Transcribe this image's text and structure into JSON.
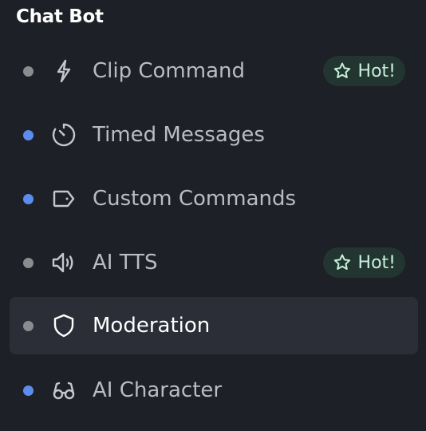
{
  "section": {
    "title": "Chat Bot"
  },
  "colors": {
    "dot_gray": "#8a8c90",
    "dot_blue": "#5b8def",
    "badge_bg": "#223530",
    "badge_text": "#c8f1dc"
  },
  "menu": {
    "items": [
      {
        "label": "Clip Command",
        "icon": "lightning-icon",
        "dot": "gray",
        "badge": "Hot!",
        "active": false
      },
      {
        "label": "Timed Messages",
        "icon": "timer-icon",
        "dot": "blue",
        "badge": null,
        "active": false
      },
      {
        "label": "Custom Commands",
        "icon": "tag-icon",
        "dot": "blue",
        "badge": null,
        "active": false
      },
      {
        "label": "AI TTS",
        "icon": "speaker-icon",
        "dot": "gray",
        "badge": "Hot!",
        "active": false
      },
      {
        "label": "Moderation",
        "icon": "shield-icon",
        "dot": "gray",
        "badge": null,
        "active": true
      },
      {
        "label": "AI Character",
        "icon": "glasses-icon",
        "dot": "blue",
        "badge": null,
        "active": false
      }
    ]
  }
}
